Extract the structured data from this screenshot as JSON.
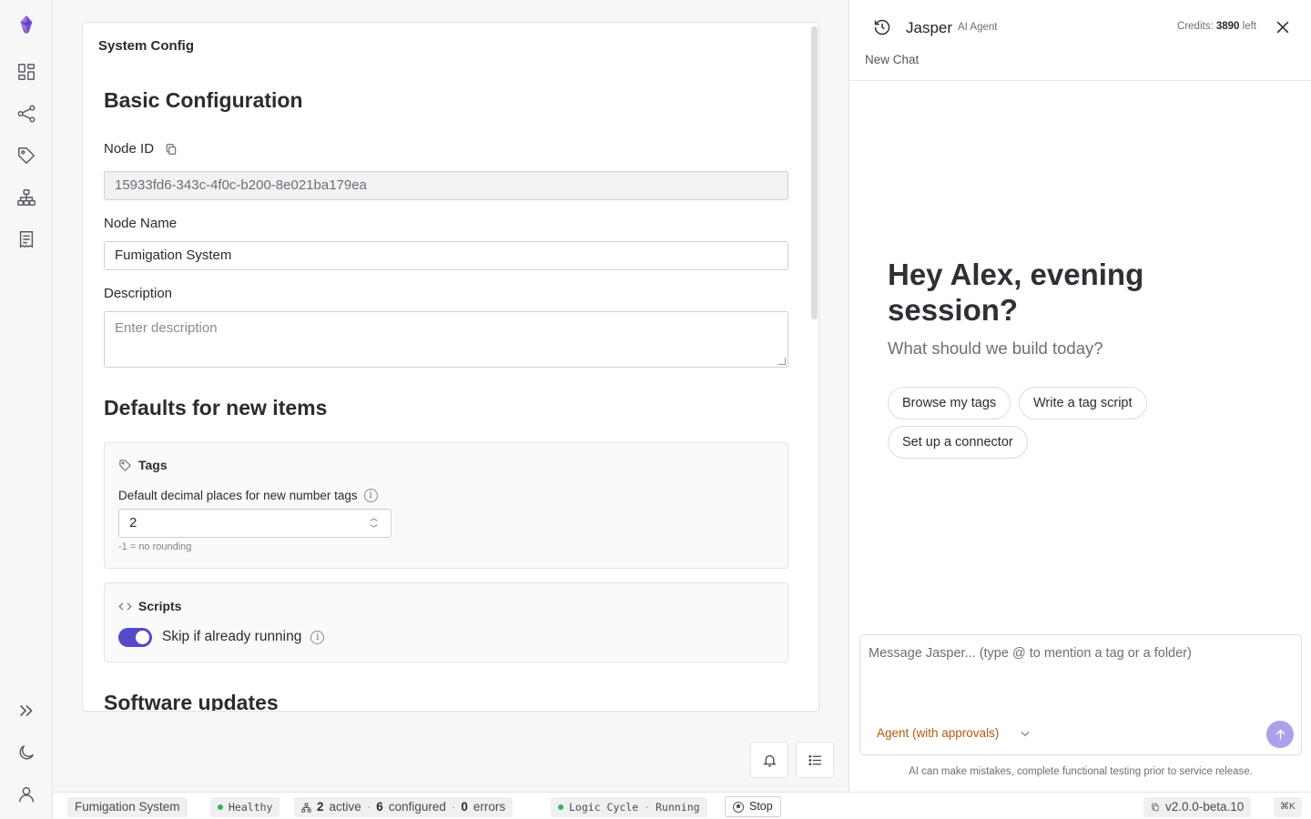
{
  "rail": {
    "icons": [
      "logo-icon",
      "dashboard-icon",
      "share-icon",
      "tag-icon",
      "hierarchy-icon",
      "receipt-icon",
      "expand-icon",
      "moon-icon",
      "user-icon"
    ]
  },
  "config": {
    "card_title": "System Config",
    "basic_heading": "Basic Configuration",
    "node_id_label": "Node ID",
    "node_id_value": "15933fd6-343c-4f0c-b200-8e021ba179ea",
    "node_name_label": "Node Name",
    "node_name_value": "Fumigation System",
    "description_label": "Description",
    "description_placeholder": "Enter description",
    "defaults_heading": "Defaults for new items",
    "tags_heading": "Tags",
    "decimal_label": "Default decimal places for new number tags",
    "decimal_value": "2",
    "decimal_hint": "-1 = no rounding",
    "scripts_heading": "Scripts",
    "skip_label": "Skip if already running",
    "skip_enabled": true,
    "updates_heading": "Software updates"
  },
  "panel": {
    "agent_name": "Jasper",
    "agent_sub": "AI Agent",
    "credits_prefix": "Credits:",
    "credits_value": "3890",
    "credits_suffix": "left",
    "new_chat": "New Chat",
    "greeting": "Hey Alex, evening session?",
    "greeting_sub": "What should we build today?",
    "chips": [
      "Browse my tags",
      "Write a tag script",
      "Set up a connector"
    ],
    "composer_placeholder": "Message Jasper... (type @ to mention a tag or a folder)",
    "mode": "Agent (with approvals)",
    "disclaimer": "AI can make mistakes, complete functional testing prior to service release."
  },
  "status": {
    "system_name": "Fumigation System",
    "health": "Healthy",
    "active_count": "2",
    "active_label": "active",
    "configured_count": "6",
    "configured_label": "configured",
    "errors_count": "0",
    "errors_label": "errors",
    "logic_label": "Logic Cycle",
    "logic_state": "Running",
    "stop_label": "Stop",
    "version": "v2.0.0-beta.10",
    "shortcut": "⌘K"
  },
  "colors": {
    "accent": "#5649c9",
    "send": "#a9a2ea",
    "mode_text": "#b35b0a",
    "healthy": "#2fb862",
    "logo": "#7b4fd1"
  }
}
